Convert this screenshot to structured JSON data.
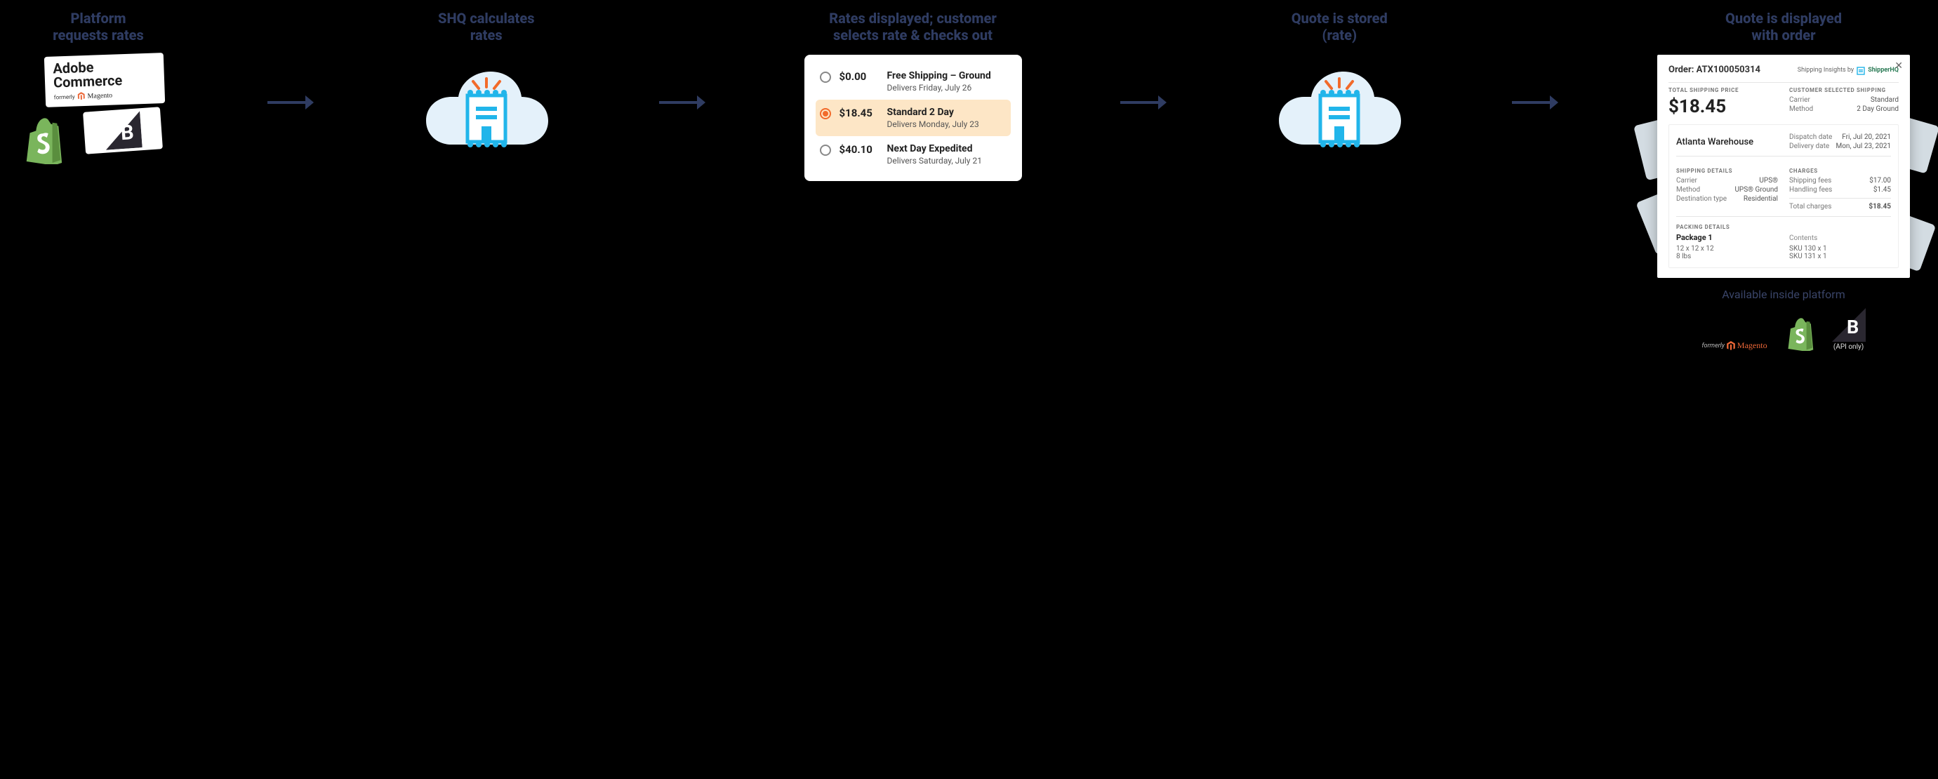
{
  "steps": {
    "s1": "Platform\nrequests rates",
    "s2": "SHQ calculates\nrates",
    "s3": "Rates displayed; customer\nselects rate & checks out",
    "s4": "Quote is stored\n(rate)",
    "s5": "Quote is displayed\nwith order"
  },
  "platforms": {
    "adobe_line1": "Adobe",
    "adobe_line2": "Commerce",
    "formerly": "formerly",
    "magento": "Magento"
  },
  "rates": [
    {
      "price": "$0.00",
      "name": "Free Shipping – Ground",
      "date": "Delivers Friday, July 26",
      "selected": false
    },
    {
      "price": "$18.45",
      "name": "Standard 2 Day",
      "date": "Delivers Monday, July 23",
      "selected": true
    },
    {
      "price": "$40.10",
      "name": "Next Day Expedited",
      "date": "Delivers Saturday, July 21",
      "selected": false
    }
  ],
  "order": {
    "title": "Order: ATX100050314",
    "insights_prefix": "Shipping Insights by",
    "brand": "ShipperHQ",
    "total_label": "TOTAL SHIPPING PRICE",
    "total": "$18.45",
    "selected_label": "CUSTOMER SELECTED SHIPPING",
    "selected_carrier_k": "Carrier",
    "selected_carrier_v": "Standard",
    "selected_method_k": "Method",
    "selected_method_v": "2 Day Ground",
    "warehouse": "Atlanta Warehouse",
    "dispatch_k": "Dispatch date",
    "dispatch_v": "Fri, Jul 20, 2021",
    "delivery_k": "Delivery date",
    "delivery_v": "Mon, Jul 23, 2021",
    "ship_hdr": "SHIPPING DETAILS",
    "ship_carrier_k": "Carrier",
    "ship_carrier_v": "UPS®",
    "ship_method_k": "Method",
    "ship_method_v": "UPS® Ground",
    "dest_k": "Destination type",
    "dest_v": "Residential",
    "charges_hdr": "CHARGES",
    "fee1_k": "Shipping fees",
    "fee1_v": "$17.00",
    "fee2_k": "Handling fees",
    "fee2_v": "$1.45",
    "total_k": "Total charges",
    "total_v": "$18.45",
    "pack_hdr": "PACKING DETAILS",
    "pkg": "Package 1",
    "dims": "12 x 12 x 12",
    "weight": "8 lbs",
    "contents_hdr": "Contents",
    "sku1": "SKU 130 x 1",
    "sku2": "SKU 131 x 1"
  },
  "footer": {
    "available": "Available inside platform",
    "api_only": "(API only)"
  }
}
